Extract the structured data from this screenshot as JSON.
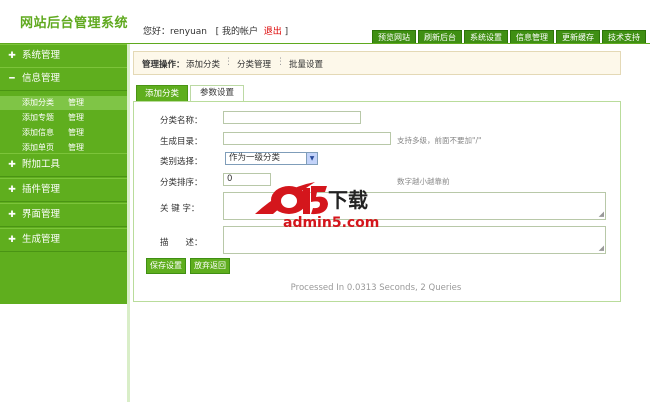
{
  "header": {
    "site_title": "网站后台管理系统",
    "greeting_prefix": "您好：renyuan",
    "my_account": "[ 我的帐户",
    "logout": "退出",
    "bracket_close": "]",
    "nav": [
      "预览网站",
      "刷新后台",
      "系统设置",
      "信息管理",
      "更新缓存",
      "技术支持"
    ]
  },
  "sidebar": {
    "sections": [
      {
        "icon": "✚",
        "label": "系统管理"
      },
      {
        "icon": "━",
        "label": "信息管理"
      },
      {
        "icon": "✚",
        "label": "附加工具"
      },
      {
        "icon": "✚",
        "label": "插件管理"
      },
      {
        "icon": "✚",
        "label": "界面管理"
      },
      {
        "icon": "✚",
        "label": "生成管理"
      }
    ],
    "sub_items": [
      {
        "label": "添加分类",
        "action": "管理"
      },
      {
        "label": "添加专题",
        "action": "管理"
      },
      {
        "label": "添加信息",
        "action": "管理"
      },
      {
        "label": "添加单页",
        "action": "管理"
      }
    ]
  },
  "opbar": {
    "title": "管理操作：",
    "items": [
      "添加分类",
      "分类管理",
      "批量设置"
    ],
    "sep": "⋮"
  },
  "tabs": [
    "添加分类",
    "参数设置"
  ],
  "form": {
    "category_name_label": "分类名称：",
    "category_name_value": "",
    "dir_label": "生成目录：",
    "dir_value": "",
    "dir_hint": "支持多级，前面不要加\"/\"",
    "type_label": "类别选择：",
    "type_value": "作为一级分类",
    "sort_label": "分类排序：",
    "sort_value": "0",
    "sort_hint": "数字越小越靠前",
    "keywords_label": "关 键 字：",
    "description_label": "描　　述："
  },
  "buttons": {
    "save": "保存设置",
    "back": "放弃返回"
  },
  "footer": "Processed In 0.0313 Seconds, 2 Queries",
  "watermark": {
    "char": "下载",
    "url": "admin5.com"
  },
  "colors": {
    "accent_green": "#5fae1e",
    "dark_green": "#3f8f13",
    "logout_red": "#dd0000"
  }
}
